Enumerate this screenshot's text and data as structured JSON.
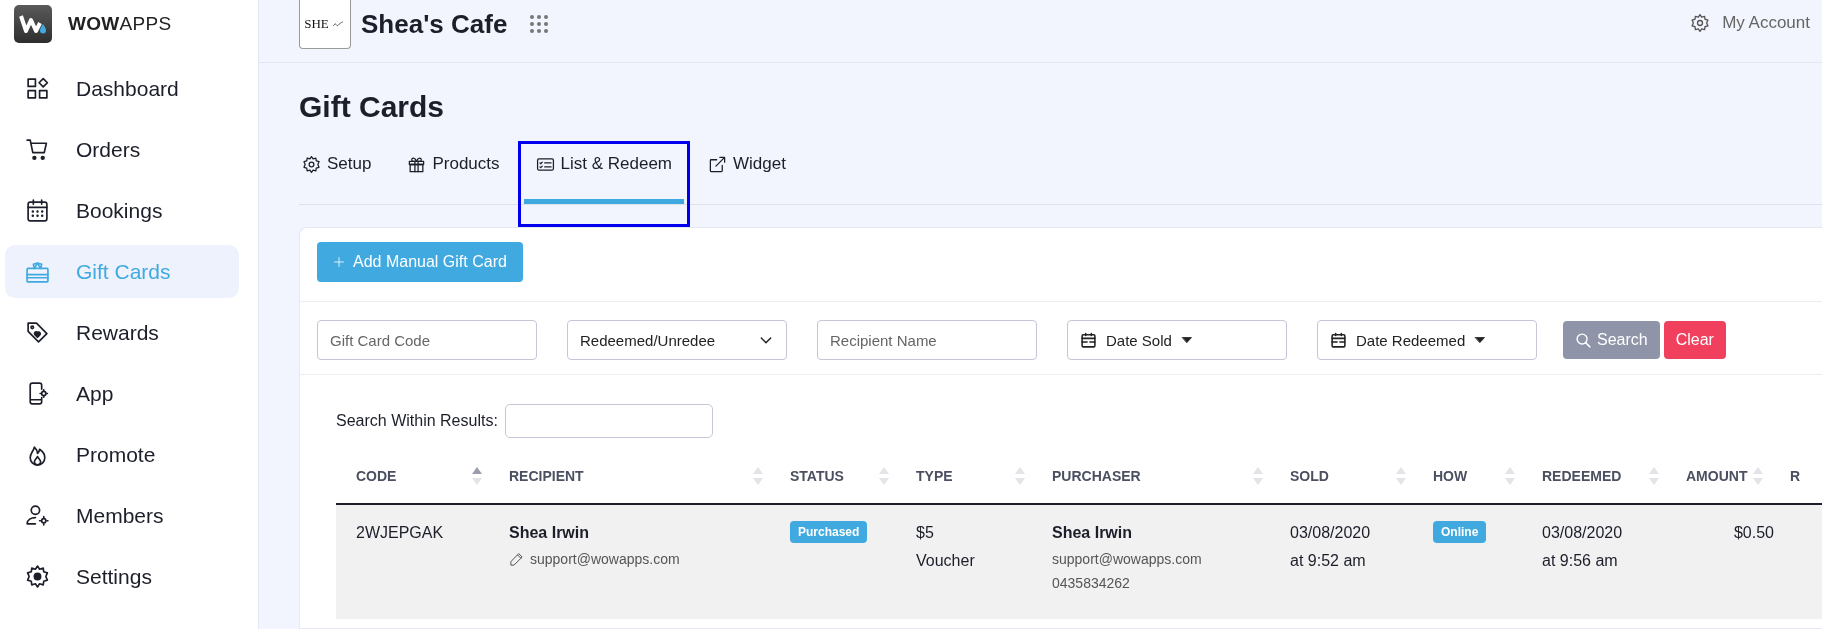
{
  "brand": {
    "name": "**WOW**APPS"
  },
  "sidebar": {
    "items": [
      {
        "label": "Dashboard",
        "selected": false
      },
      {
        "label": "Orders",
        "selected": false
      },
      {
        "label": "Bookings",
        "selected": false
      },
      {
        "label": "Gift Cards",
        "selected": true
      },
      {
        "label": "Rewards",
        "selected": false
      },
      {
        "label": "App",
        "selected": false
      },
      {
        "label": "Promote",
        "selected": false
      },
      {
        "label": "Members",
        "selected": false
      },
      {
        "label": "Settings",
        "selected": false
      }
    ]
  },
  "header": {
    "logo_text": "SHE",
    "business_name": "Shea's Cafe",
    "account": "My Account"
  },
  "page_title": "Gift Cards",
  "tabs": [
    {
      "label": "Setup",
      "selected": false,
      "highlighted": false
    },
    {
      "label": "Products",
      "selected": false,
      "highlighted": false
    },
    {
      "label": "List & Redeem",
      "selected": true,
      "highlighted": true
    },
    {
      "label": "Widget",
      "selected": false,
      "highlighted": false
    }
  ],
  "add_button": {
    "label": "Add Manual Gift Card"
  },
  "filters": [
    {
      "kind": "text",
      "placeholder": "Gift Card Code"
    },
    {
      "kind": "select",
      "value": "Redeemed/Unredee"
    },
    {
      "kind": "text",
      "placeholder": "Recipient Name"
    },
    {
      "kind": "date",
      "value": "Date Sold"
    },
    {
      "kind": "date",
      "value": "Date Redeemed"
    }
  ],
  "search_button": "Search",
  "clear_button": "Clear",
  "search_within": {
    "label": "Search Within Results:"
  },
  "table": {
    "columns": [
      {
        "label": "CODE",
        "sorted": true
      },
      {
        "label": "RECIPIENT",
        "sorted": false
      },
      {
        "label": "STATUS",
        "sorted": false
      },
      {
        "label": "TYPE",
        "sorted": false
      },
      {
        "label": "PURCHASER",
        "sorted": false
      },
      {
        "label": "SOLD",
        "sorted": false
      },
      {
        "label": "HOW",
        "sorted": false
      },
      {
        "label": "REDEEMED",
        "sorted": false
      },
      {
        "label": "AMOUNT",
        "sorted": false
      },
      {
        "label": "R"
      }
    ],
    "rows": [
      {
        "code": "2WJEPGAK",
        "recipient": {
          "name": "Shea Irwin",
          "email": "support@wowapps.com"
        },
        "status": "Purchased",
        "type": "$5\nVoucher",
        "purchaser": {
          "name": "Shea Irwin",
          "email": "support@wowapps.com",
          "phone": "0435834262"
        },
        "sold": "03/08/2020\nat 9:52 am",
        "how": "Online",
        "redeemed": "03/08/2020\nat 9:56 am",
        "amount": "$0.50"
      }
    ]
  }
}
